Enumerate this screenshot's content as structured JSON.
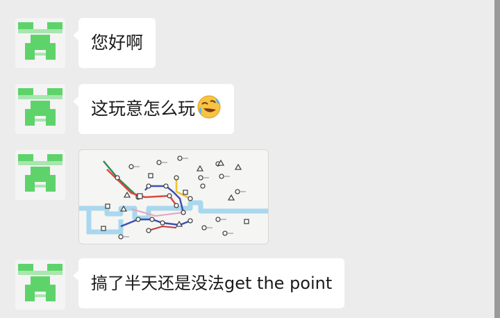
{
  "messages": [
    {
      "type": "text",
      "text": "您好啊"
    },
    {
      "type": "text",
      "text": "这玩意怎么玩",
      "emoji": "rolling-on-floor-laughing-emoji"
    },
    {
      "type": "image",
      "image": "subway-map-game-screenshot"
    },
    {
      "type": "text",
      "text": "搞了半天还是没法get the point"
    }
  ],
  "colors": {
    "background": "#ececec",
    "bubble": "#ffffff",
    "avatar_green": "#5ed36a",
    "map_river": "#a9d8ee"
  }
}
